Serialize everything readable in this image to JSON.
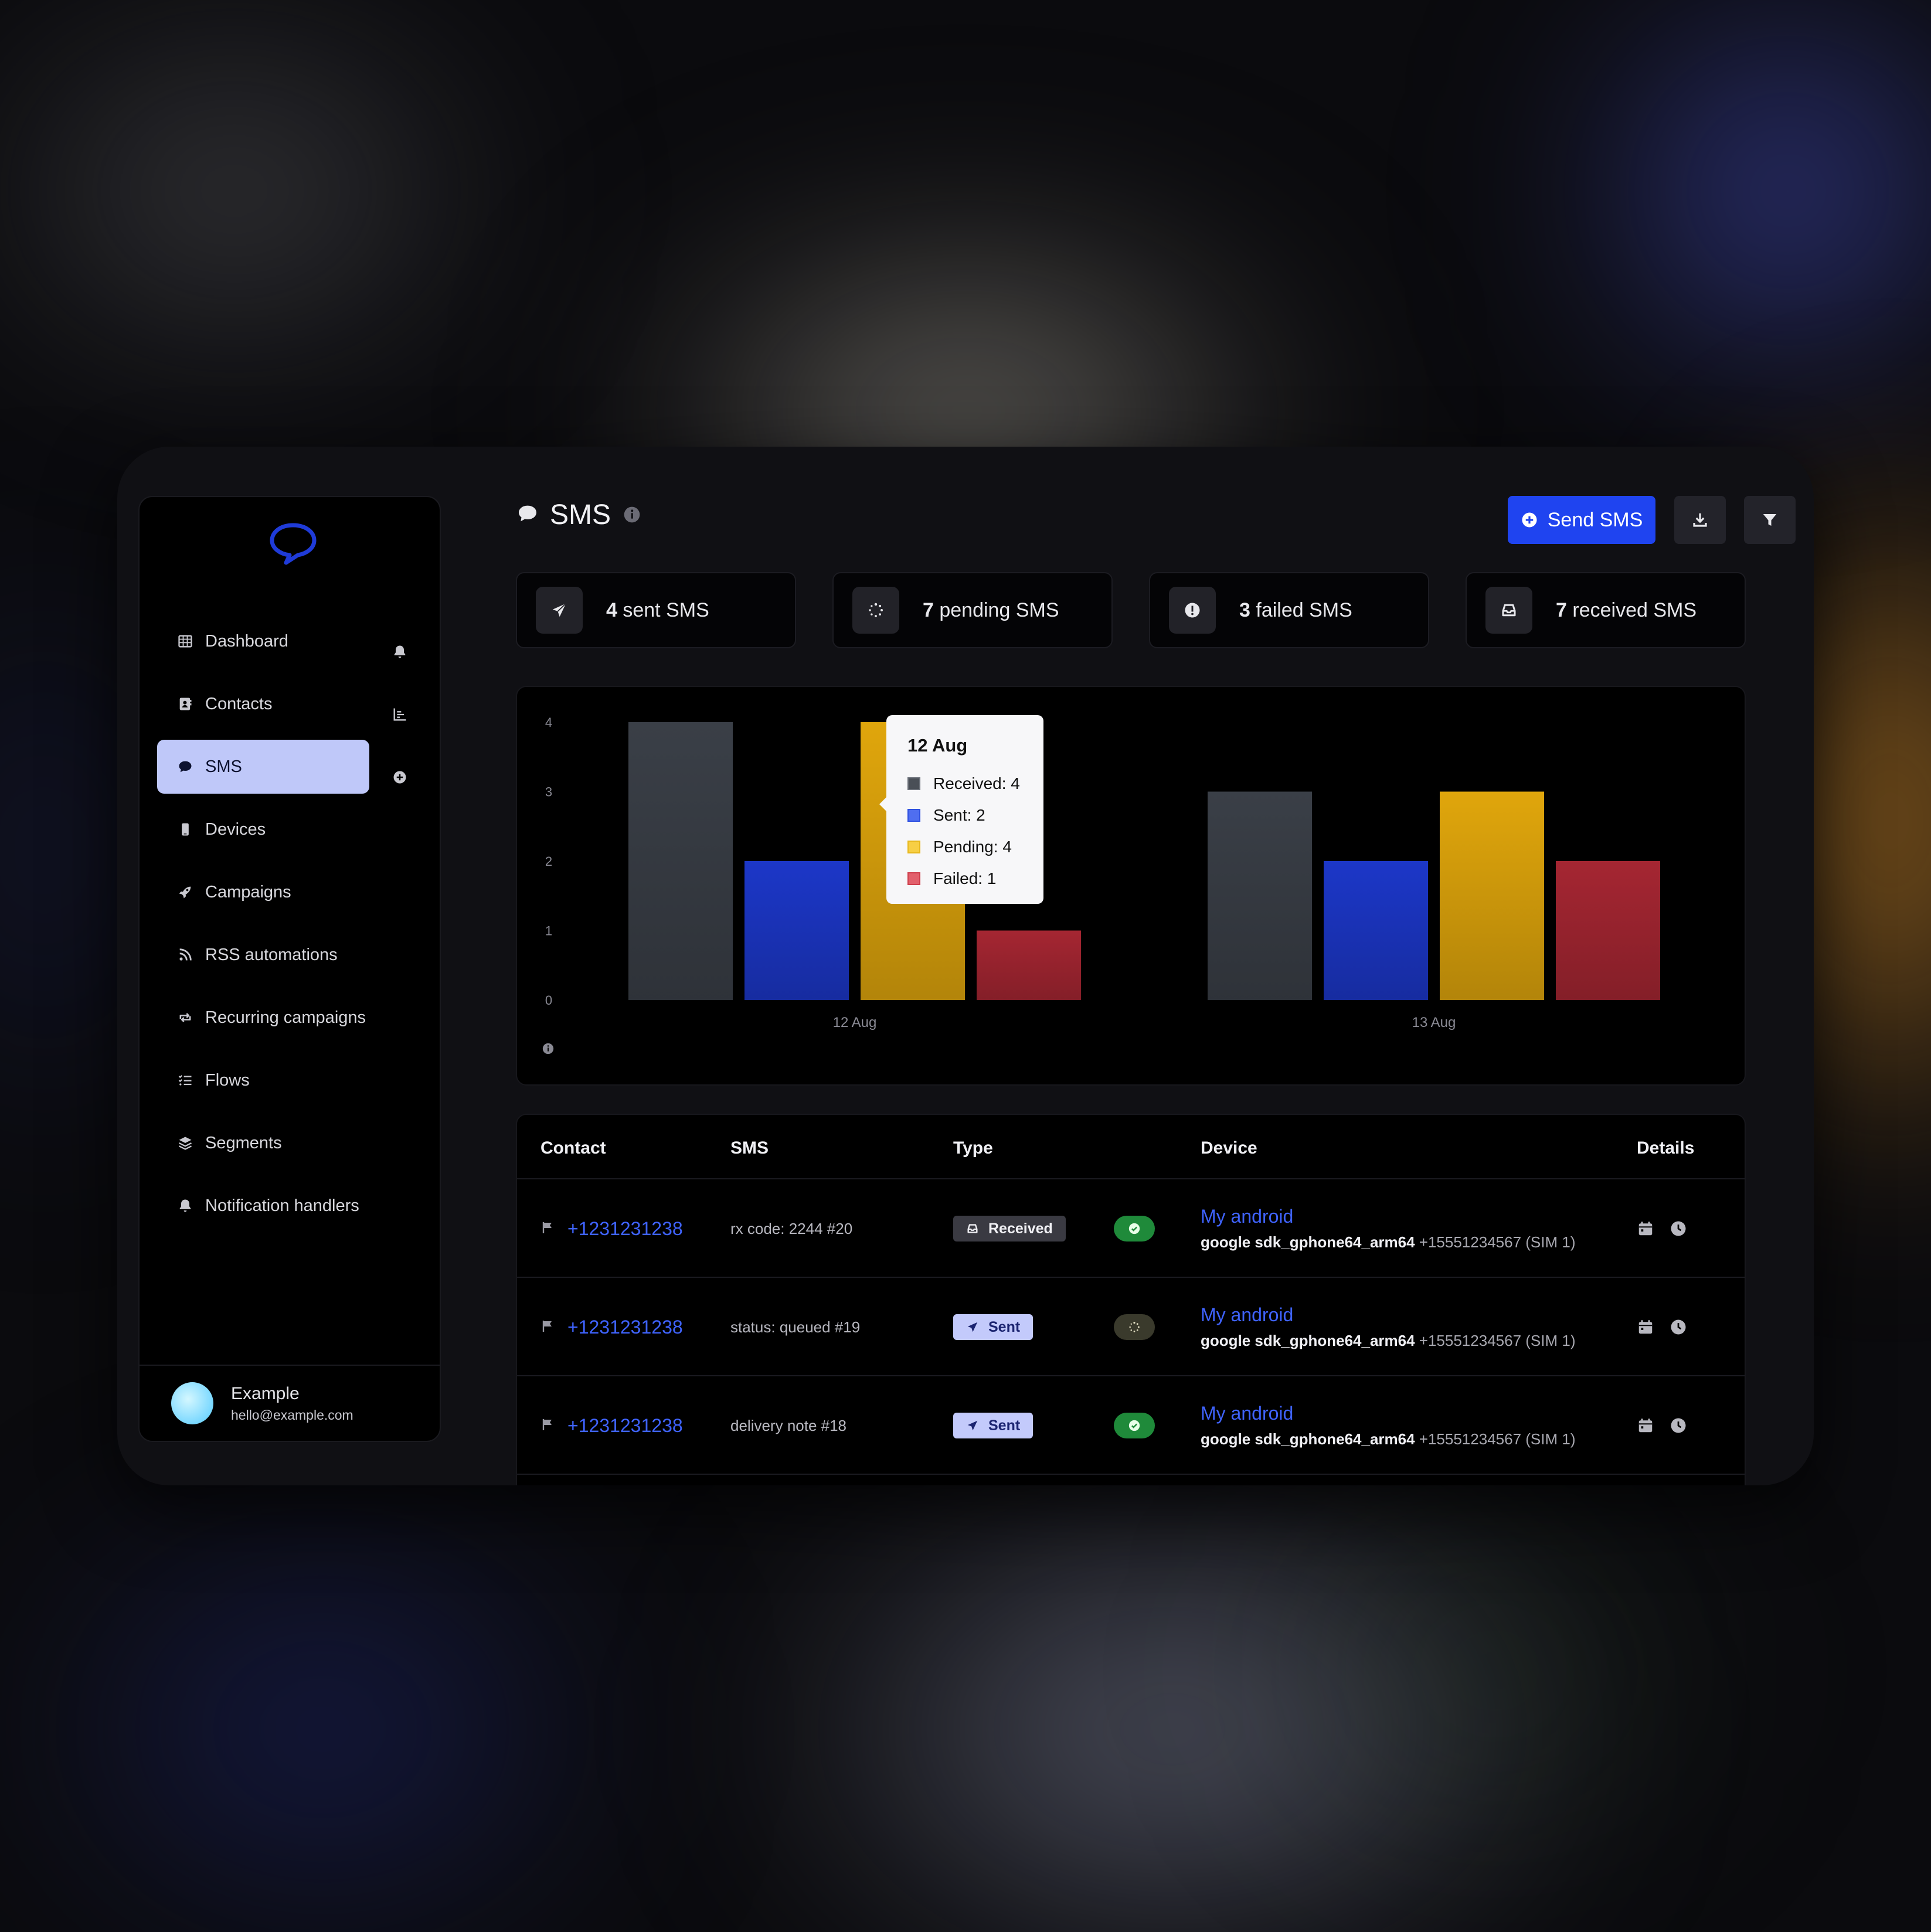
{
  "sidebar": {
    "items": [
      {
        "label": "Dashboard",
        "icon": "table-icon"
      },
      {
        "label": "Contacts",
        "icon": "address-book-icon"
      },
      {
        "label": "SMS",
        "icon": "chat-bubble-icon"
      },
      {
        "label": "Devices",
        "icon": "phone-icon"
      },
      {
        "label": "Campaigns",
        "icon": "rocket-icon"
      },
      {
        "label": "RSS automations",
        "icon": "rss-icon"
      },
      {
        "label": "Recurring campaigns",
        "icon": "repeat-icon"
      },
      {
        "label": "Flows",
        "icon": "list-check-icon"
      },
      {
        "label": "Segments",
        "icon": "layers-icon"
      },
      {
        "label": "Notification handlers",
        "icon": "bell-icon"
      }
    ],
    "active_item": "SMS",
    "user": {
      "name": "Example",
      "email": "hello@example.com"
    }
  },
  "header": {
    "title": "SMS",
    "send_label": "Send SMS"
  },
  "stats": [
    {
      "count": "4",
      "label": " sent SMS",
      "icon": "paper-plane-icon"
    },
    {
      "count": "7",
      "label": " pending SMS",
      "icon": "spinner-icon"
    },
    {
      "count": "3",
      "label": " failed SMS",
      "icon": "alert-circle-icon"
    },
    {
      "count": "7",
      "label": " received SMS",
      "icon": "inbox-icon"
    }
  ],
  "colors": {
    "accent": "#1f44f0",
    "received": "#3a3f47",
    "sent": "#1c37c8",
    "pending": "#e0a60c",
    "failed": "#a52632",
    "link": "#3f63ff"
  },
  "chart_data": {
    "type": "bar",
    "categories": [
      "12 Aug",
      "13 Aug"
    ],
    "series": [
      {
        "name": "Received",
        "values": [
          4,
          3
        ]
      },
      {
        "name": "Sent",
        "values": [
          2,
          2
        ]
      },
      {
        "name": "Pending",
        "values": [
          4,
          3
        ]
      },
      {
        "name": "Failed",
        "values": [
          1,
          2
        ]
      }
    ],
    "ylim": [
      0,
      4
    ],
    "yticks": [
      "0",
      "1",
      "2",
      "3",
      "4"
    ],
    "grid": false,
    "tooltip": {
      "title": "12 Aug",
      "rows": [
        "Received: 4",
        "Sent: 2",
        "Pending: 4",
        "Failed: 1"
      ]
    }
  },
  "table": {
    "headers": {
      "contact": "Contact",
      "sms": "SMS",
      "type": "Type",
      "device": "Device",
      "details": "Details"
    },
    "rows": [
      {
        "contact": "+1231231238",
        "sms": "rx code: 2244 #20",
        "type": "Received",
        "status": "delivered",
        "device_name": "My android",
        "device_model": "google sdk_gphone64_arm64",
        "device_number": " +15551234567 (SIM 1)"
      },
      {
        "contact": "+1231231238",
        "sms": "status: queued #19",
        "type": "Sent",
        "status": "pending",
        "device_name": "My android",
        "device_model": "google sdk_gphone64_arm64",
        "device_number": " +15551234567 (SIM 1)"
      },
      {
        "contact": "+1231231238",
        "sms": "delivery note #18",
        "type": "Sent",
        "status": "delivered",
        "device_name": "My android",
        "device_model": "google sdk_gphone64_arm64",
        "device_number": " +15551234567 (SIM 1)"
      }
    ]
  }
}
